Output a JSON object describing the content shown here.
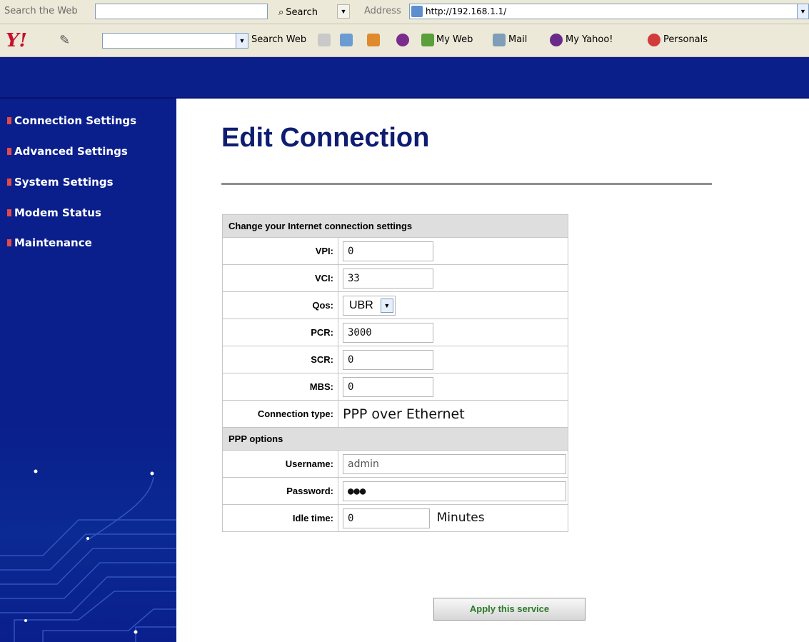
{
  "browser": {
    "search_label": "Search the Web",
    "search_button": "Search",
    "address_label": "Address",
    "address_url": "http://192.168.1.1/"
  },
  "yahoo_toolbar": {
    "logo": "Y!",
    "search_web": "Search Web",
    "my_web": "My Web",
    "mail": "Mail",
    "my_yahoo": "My Yahoo!",
    "personals": "Personals"
  },
  "sidebar": {
    "items": [
      {
        "label": "Connection Settings"
      },
      {
        "label": "Advanced Settings"
      },
      {
        "label": "System Settings"
      },
      {
        "label": "Modem Status"
      },
      {
        "label": "Maintenance"
      }
    ]
  },
  "page": {
    "title": "Edit Connection"
  },
  "form": {
    "section1_header": "Change your Internet connection settings",
    "vpi": {
      "label": "VPI:",
      "value": "0"
    },
    "vci": {
      "label": "VCI:",
      "value": "33"
    },
    "qos": {
      "label": "Qos:",
      "value": "UBR"
    },
    "pcr": {
      "label": "PCR:",
      "value": "3000"
    },
    "scr": {
      "label": "SCR:",
      "value": "0"
    },
    "mbs": {
      "label": "MBS:",
      "value": "0"
    },
    "connection_type": {
      "label": "Connection type:",
      "value": "PPP over Ethernet"
    },
    "section2_header": "PPP options",
    "username": {
      "label": "Username:",
      "value": "admin"
    },
    "password": {
      "label": "Password:",
      "value": "●●●"
    },
    "idle_time": {
      "label": "Idle time:",
      "value": "0",
      "unit": "Minutes"
    },
    "apply_button": "Apply this service"
  },
  "colors": {
    "banner": "#0b1f8a",
    "title": "#0e1d72",
    "apply_text": "#2c7a2c"
  }
}
